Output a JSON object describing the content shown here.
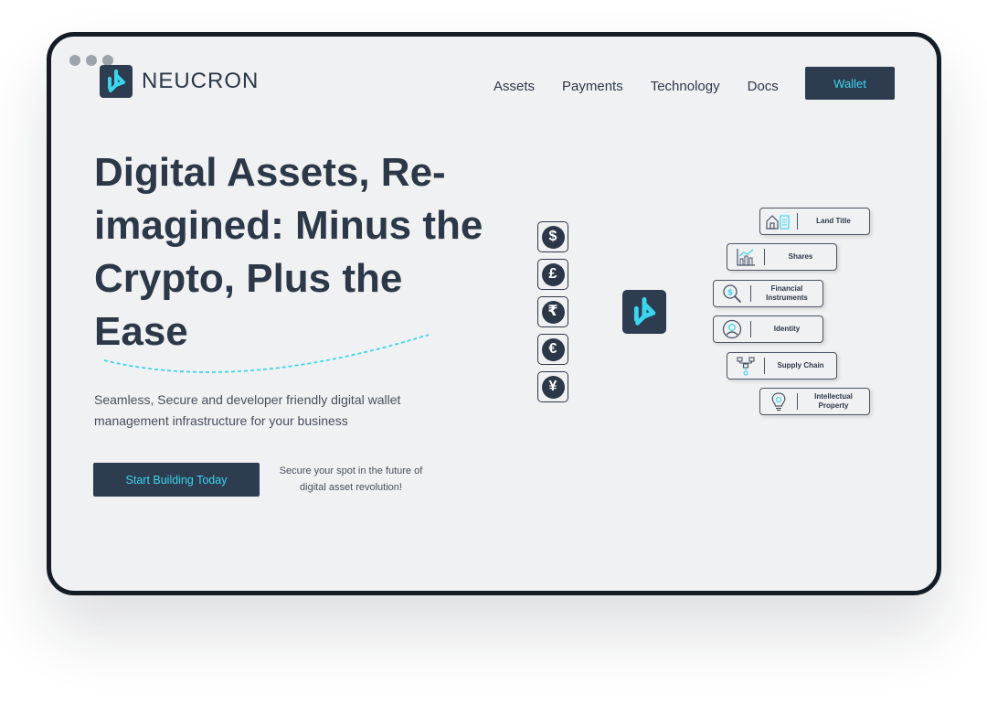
{
  "brand": {
    "name": "NEUCRON",
    "accent_color": "#3bd6ee",
    "dark_color": "#2e3c50"
  },
  "window_controls": [
    "window-dot",
    "window-dot",
    "window-dot"
  ],
  "nav": {
    "links": [
      "Assets",
      "Payments",
      "Technology",
      "Docs"
    ],
    "wallet_label": "Wallet"
  },
  "hero": {
    "headline": "Digital Assets, Re-imagined: Minus the Crypto, Plus the Ease",
    "subtext": "Seamless, Secure and developer friendly digital wallet management infrastructure for your business",
    "cta_label": "Start Building Today",
    "cta_note": "Secure your spot in the future of digital asset revolution!"
  },
  "currencies": [
    {
      "symbol": "$",
      "icon": "dollar-icon"
    },
    {
      "symbol": "£",
      "icon": "pound-icon"
    },
    {
      "symbol": "₹",
      "icon": "rupee-icon"
    },
    {
      "symbol": "€",
      "icon": "euro-icon"
    },
    {
      "symbol": "¥",
      "icon": "yen-icon"
    }
  ],
  "asset_tags": [
    {
      "label": "Land Title",
      "icon": "house-icon"
    },
    {
      "label": "Shares",
      "icon": "bar-chart-icon"
    },
    {
      "label": "Financial Instruments",
      "icon": "magnifier-dollar-icon"
    },
    {
      "label": "Identity",
      "icon": "user-circle-icon"
    },
    {
      "label": "Supply Chain",
      "icon": "network-icon"
    },
    {
      "label": "Intellectual Property",
      "icon": "lightbulb-icon"
    }
  ]
}
